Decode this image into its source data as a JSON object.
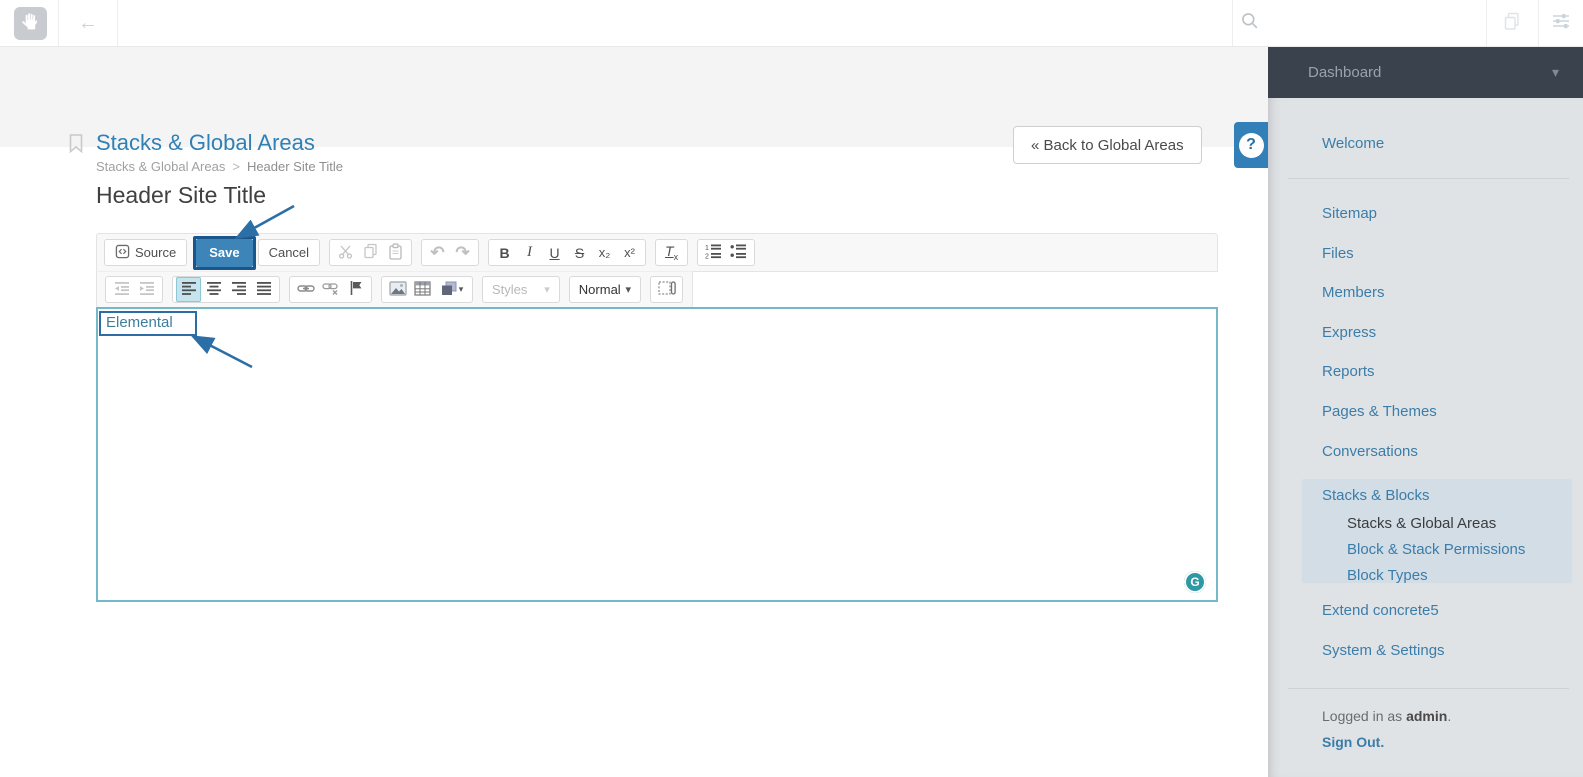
{
  "colors": {
    "accent_blue": "#3380b8",
    "title_blue": "#2f80b5",
    "sidebar_link_blue": "#3b7da9",
    "sidebar_bg": "#e0e3e6",
    "sidebar_highlight_bg": "#d2dde6",
    "sidebar_dark_header": "#39424d",
    "save_button_bg": "#3d85b8",
    "annotation_outline": "#1a568b",
    "annotation_arrow": "#2b6fa6",
    "editor_border_teal": "#74b9c9",
    "grammarly_teal": "#2e98a4"
  },
  "topbar": {
    "back_glyph": "←"
  },
  "page_header": {
    "title": "Stacks & Global Areas",
    "breadcrumb": {
      "root": "Stacks & Global Areas",
      "separator": ">",
      "current": "Header Site Title"
    },
    "back_button_label": "« Back to Global Areas",
    "help_label": "?"
  },
  "main": {
    "heading": "Header Site Title"
  },
  "editor": {
    "toolbar": {
      "source": "Source",
      "save": "Save",
      "cancel": "Cancel",
      "undo_glyph": "↶",
      "redo_glyph": "↷",
      "bold": "B",
      "italic": "I",
      "underline": "U",
      "strikethrough": "S",
      "subscript": "x₂",
      "superscript": "x²",
      "remove_format_t": "T",
      "remove_format_x": "x",
      "styles": "Styles",
      "format": "Normal",
      "caret_glyph": "▾"
    },
    "content_text": "Elemental",
    "grammarly_label": "G"
  },
  "sidebar": {
    "header_label": "Dashboard",
    "caret_glyph": "▾",
    "items": [
      {
        "label": "Welcome"
      },
      {
        "label": "Sitemap"
      },
      {
        "label": "Files"
      },
      {
        "label": "Members"
      },
      {
        "label": "Express"
      },
      {
        "label": "Reports"
      },
      {
        "label": "Pages & Themes"
      },
      {
        "label": "Conversations"
      },
      {
        "label": "Stacks & Blocks"
      },
      {
        "label": "Stacks & Global Areas"
      },
      {
        "label": "Block & Stack Permissions"
      },
      {
        "label": "Block Types"
      },
      {
        "label": "Extend concrete5"
      },
      {
        "label": "System & Settings"
      }
    ],
    "footer": {
      "logged_in_prefix": "Logged in as ",
      "username": "admin",
      "period": ".",
      "sign_out": "Sign Out."
    }
  }
}
